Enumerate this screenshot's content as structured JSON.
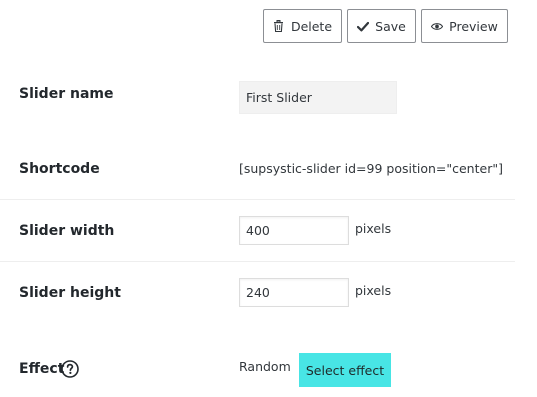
{
  "toolbar": {
    "delete_label": "Delete",
    "save_label": "Save",
    "preview_label": "Preview",
    "delete_icon": "trash-icon",
    "save_icon": "checkmark-icon",
    "preview_icon": "eye-icon"
  },
  "form": {
    "slider_name": {
      "label": "Slider name",
      "value": "First Slider"
    },
    "shortcode": {
      "label": "Shortcode",
      "value": "[supsystic-slider id=99 position=\"center\"]"
    },
    "slider_width": {
      "label": "Slider width",
      "value": "400",
      "unit": "pixels"
    },
    "slider_height": {
      "label": "Slider height",
      "value": "240",
      "unit": "pixels"
    },
    "effect": {
      "label": "Effect",
      "help_icon": "question-circle-icon",
      "current_value": "Random",
      "select_button_label": "Select effect"
    }
  },
  "colors": {
    "effect_button_bg": "#48e5e5",
    "divider": "#eeeeee"
  }
}
